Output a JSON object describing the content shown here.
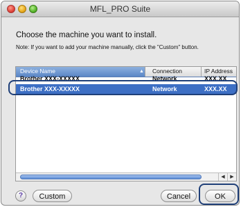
{
  "window": {
    "title": "MFL_PRO Suite"
  },
  "heading": "Choose the machine you want to install.",
  "note": "Note: If you want to add your machine manually, click the \"Custom\" button.",
  "list": {
    "columns": [
      "Device Name",
      "Connection",
      "IP Address"
    ],
    "rows": [
      {
        "device": "Brother XXX-XXXXX",
        "connection": "Network",
        "ip": "XXX.XX"
      },
      {
        "device": "Brother XXX-XXXXX",
        "connection": "Network",
        "ip": "XXX.XX",
        "selected": true
      }
    ]
  },
  "buttons": {
    "help": "?",
    "custom": "Custom",
    "cancel": "Cancel",
    "ok": "OK"
  },
  "icons": {
    "close": "close-icon",
    "minimize": "minimize-icon",
    "zoom": "zoom-icon",
    "sort": "sort-arrow-icon",
    "scroll_left": "scroll-left-icon",
    "scroll_right": "scroll-right-icon",
    "help": "help-icon"
  },
  "colors": {
    "selection": "#3d6fc4",
    "callout": "#1f3f78"
  }
}
